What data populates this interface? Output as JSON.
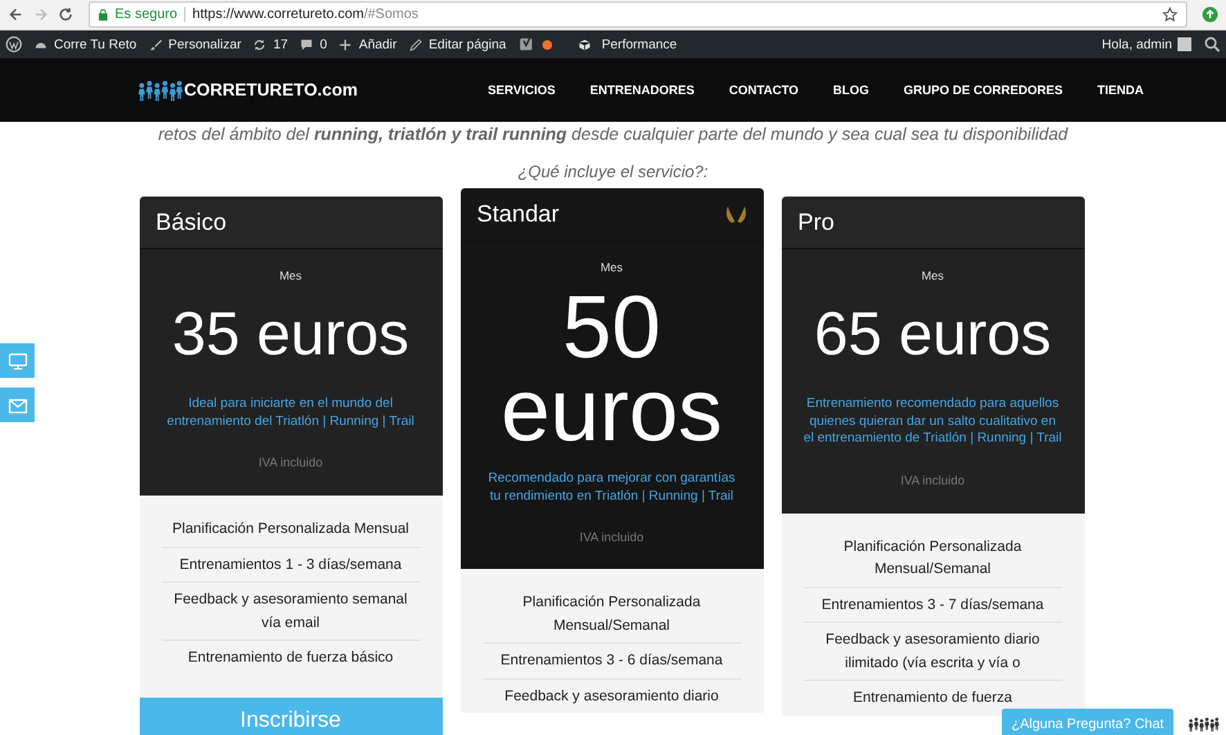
{
  "browser": {
    "security_label": "Es seguro",
    "url_host": "https://www.corretureto.com",
    "url_path": "/#Somos"
  },
  "admin_bar": {
    "items": [
      {
        "kind": "wp"
      },
      {
        "kind": "site",
        "label": "Corre Tu Reto"
      },
      {
        "kind": "brush",
        "label": "Personalizar"
      },
      {
        "kind": "updates",
        "label": "17"
      },
      {
        "kind": "comments",
        "label": "0"
      },
      {
        "kind": "add",
        "label": "Añadir"
      },
      {
        "kind": "edit",
        "label": "Editar página"
      },
      {
        "kind": "seo"
      },
      {
        "kind": "performance",
        "label": "Performance"
      }
    ],
    "greeting": "Hola, admin"
  },
  "nav": {
    "logo": "CORRETURETO.com",
    "links": [
      "SERVICIOS",
      "ENTRENADORES",
      "CONTACTO",
      "BLOG",
      "GRUPO DE CORREDORES",
      "TIENDA"
    ]
  },
  "intro": "retos del ámbito del **running, triatlón y trail running** desde cualquier parte del mundo y sea cual sea tu disponibilidad",
  "question": "¿Qué incluye el servicio?:",
  "plans": [
    {
      "name": "Básico",
      "featured": false,
      "period": "Mes",
      "price": "35 euros",
      "description": "Ideal para iniciarte en el mundo del entrenamiento del Triatlón | Running | Trail",
      "tax": "IVA incluido",
      "features": [
        "Planificación Personalizada Mensual",
        "Entrenamientos 1 - 3 días/semana",
        "Feedback y asesoramiento semanal vía email",
        "Entrenamiento de fuerza básico"
      ],
      "button": "Inscribirse"
    },
    {
      "name": "Standar",
      "featured": true,
      "period": "Mes",
      "price": "50 euros",
      "description": "Recomendado para mejorar con garantías tu rendimiento en Triatlón | Running | Trail",
      "tax": "IVA incluido",
      "features": [
        "Planificación Personalizada Mensual/Semanal",
        "Entrenamientos 3 - 6 días/semana",
        "Feedback y asesoramiento diario"
      ]
    },
    {
      "name": "Pro",
      "featured": false,
      "period": "Mes",
      "price": "65 euros",
      "description": "Entrenamiento recomendado para aquellos quienes quieran dar un salto cualitativo en el entrenamiento de Triatlón | Running | Trail",
      "tax": "IVA incluido",
      "features": [
        "Planificación Personalizada Mensual/Semanal",
        "Entrenamientos 3 - 7 días/semana",
        "Feedback y asesoramiento diario ilimitado (vía escrita y vía o",
        "Entrenamiento de fuerza"
      ]
    }
  ],
  "side_buttons": [
    {
      "kind": "screen"
    },
    {
      "kind": "mail"
    }
  ],
  "chat": {
    "label": "¿Alguna Pregunta? Chat"
  }
}
